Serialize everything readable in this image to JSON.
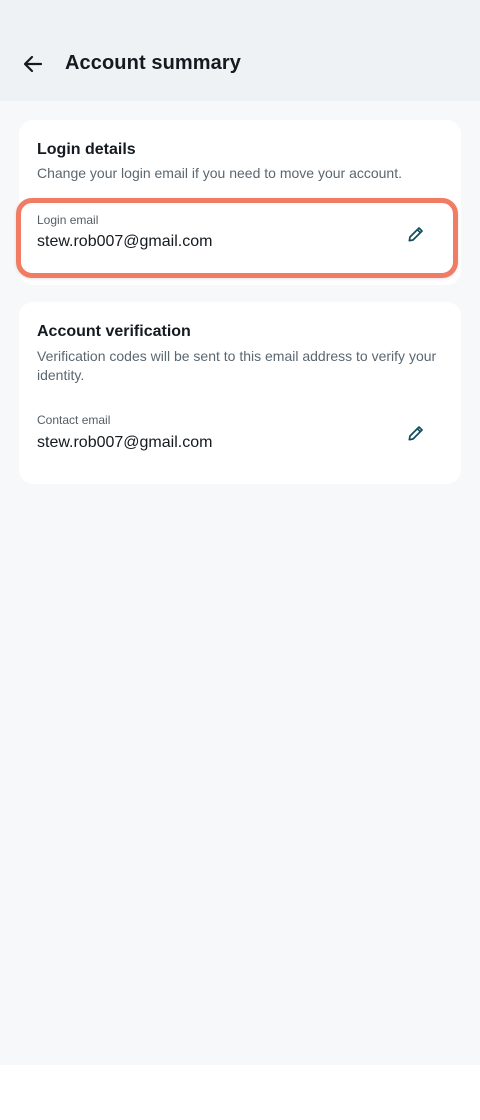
{
  "header": {
    "title": "Account summary",
    "back_icon": "arrow-left-icon"
  },
  "login_details": {
    "heading": "Login details",
    "description": "Change your login email if you need to move your account.",
    "field_label": "Login email",
    "field_value": "stew.rob007@gmail.com",
    "edit_icon": "pencil-icon",
    "highlight_color": "#f07c63"
  },
  "account_verification": {
    "heading": "Account verification",
    "description": "Verification codes will be sent to this email address to verify your identity.",
    "field_label": "Contact email",
    "field_value": "stew.rob007@gmail.com",
    "edit_icon": "pencil-icon"
  },
  "colors": {
    "header_bg": "#eff2f4",
    "page_bg": "#f7f8fa",
    "icon_accent": "#0f4c5c"
  }
}
